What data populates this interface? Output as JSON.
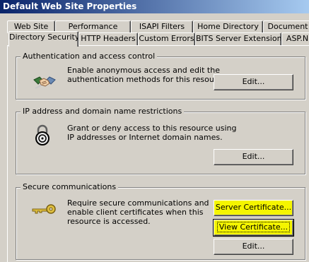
{
  "window": {
    "title": "Default Web Site Properties"
  },
  "tabs_back": [
    "Web Site",
    "Performance",
    "ISAPI Filters",
    "Home Directory",
    "Document"
  ],
  "tabs_front": [
    "Directory Security",
    "HTTP Headers",
    "Custom Errors",
    "BITS Server Extension",
    "ASP.N"
  ],
  "auth": {
    "title": "Authentication and access control",
    "description_line1": "Enable anonymous access and edit the",
    "description_line2": "authentication methods for this resource.",
    "edit_label": "Edit...",
    "icon": "handshake-icon"
  },
  "ip": {
    "title": "IP address and domain name restrictions",
    "description_line1": "Grant or deny access to this resource using",
    "description_line2": "IP addresses or Internet domain names.",
    "edit_label": "Edit...",
    "icon": "padlock-icon"
  },
  "secure": {
    "title": "Secure communications",
    "description_line1": "Require secure communications and",
    "description_line2": "enable client certificates when this",
    "description_line3": "resource is accessed.",
    "server_cert_label": "Server Certificate...",
    "view_cert_label": "View Certificate...",
    "edit_label": "Edit...",
    "icon": "key-icon"
  },
  "colors": {
    "highlight": "#f5f500",
    "titlebar": "#0a246a",
    "face": "#d4d0c8"
  }
}
